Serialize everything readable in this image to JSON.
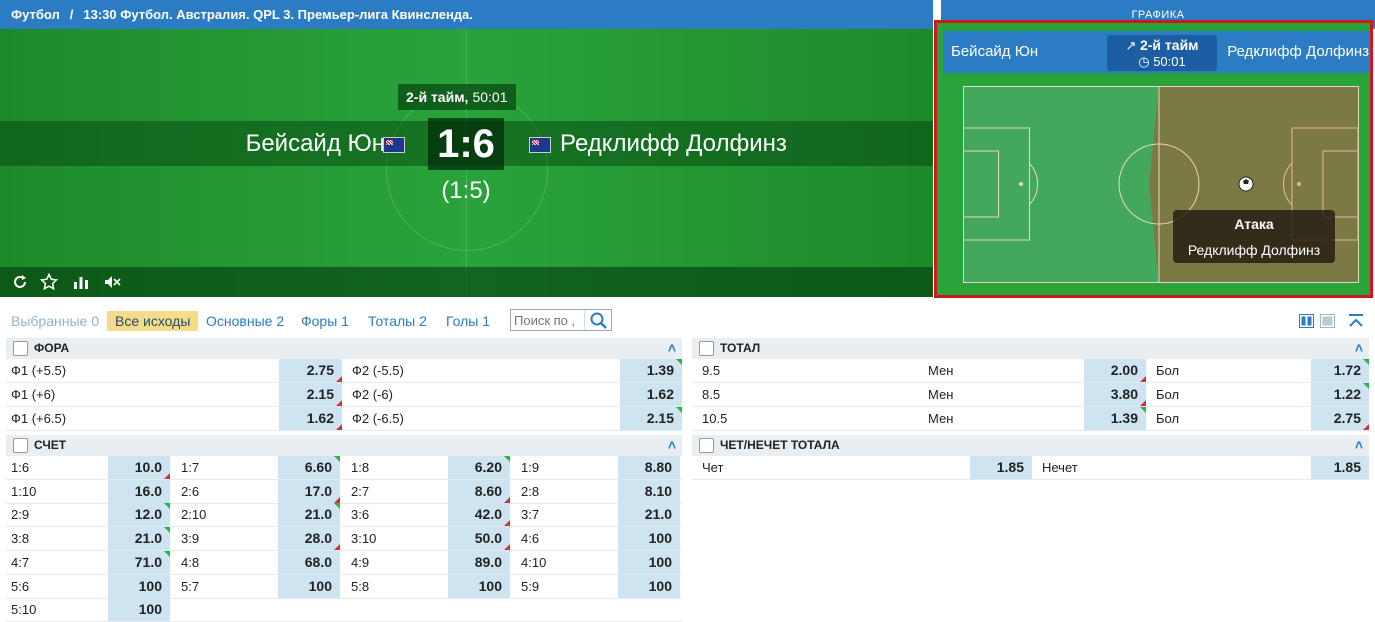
{
  "header": {
    "sport": "Футбол",
    "separator": "/",
    "match_title": "13:30 Футбол. Австралия. QPL 3. Премьер-лига Квинсленда."
  },
  "graphics_tab": "ГРАФИКА",
  "scoreboard": {
    "period": "2-й тайм,",
    "time": "50:01",
    "team1": "Бейсайд Юн",
    "team2": "Редклифф Долфинз",
    "score": "1:6",
    "half_score": "(1:5)"
  },
  "graphics": {
    "team1": "Бейсайд Юн",
    "team2": "Редклифф Долфинз",
    "period": "2-й тайм",
    "time": "50:01",
    "event_title": "Атака",
    "event_team": "Редклифф Долфинз"
  },
  "filters": [
    {
      "label": "Выбранные 0",
      "state": "disabled"
    },
    {
      "label": "Все исходы",
      "state": "active"
    },
    {
      "label": "Основные 2",
      "state": "normal"
    },
    {
      "label": "Форы 1",
      "state": "normal"
    },
    {
      "label": "Тоталы 2",
      "state": "normal"
    },
    {
      "label": "Голы 1",
      "state": "normal"
    }
  ],
  "search": {
    "placeholder": "Поиск по ,"
  },
  "fora": {
    "title": "ФОРА",
    "rows": [
      {
        "l1": "Ф1 (+5.5)",
        "o1": "2.75",
        "l2": "Ф2 (-5.5)",
        "o2": "1.39"
      },
      {
        "l1": "Ф1 (+6)",
        "o1": "2.15",
        "l2": "Ф2 (-6)",
        "o2": "1.62"
      },
      {
        "l1": "Ф1 (+6.5)",
        "o1": "1.62",
        "l2": "Ф2 (-6.5)",
        "o2": "2.15"
      }
    ]
  },
  "score": {
    "title": "СЧЕТ",
    "rows": [
      [
        [
          "1:6",
          "10.0"
        ],
        [
          "1:7",
          "6.60"
        ],
        [
          "1:8",
          "6.20"
        ],
        [
          "1:9",
          "8.80"
        ]
      ],
      [
        [
          "1:10",
          "16.0"
        ],
        [
          "2:6",
          "17.0"
        ],
        [
          "2:7",
          "8.60"
        ],
        [
          "2:8",
          "8.10"
        ]
      ],
      [
        [
          "2:9",
          "12.0"
        ],
        [
          "2:10",
          "21.0"
        ],
        [
          "3:6",
          "42.0"
        ],
        [
          "3:7",
          "21.0"
        ]
      ],
      [
        [
          "3:8",
          "21.0"
        ],
        [
          "3:9",
          "28.0"
        ],
        [
          "3:10",
          "50.0"
        ],
        [
          "4:6",
          "100"
        ]
      ],
      [
        [
          "4:7",
          "71.0"
        ],
        [
          "4:8",
          "68.0"
        ],
        [
          "4:9",
          "89.0"
        ],
        [
          "4:10",
          "100"
        ]
      ],
      [
        [
          "5:6",
          "100"
        ],
        [
          "5:7",
          "100"
        ],
        [
          "5:8",
          "100"
        ],
        [
          "5:9",
          "100"
        ]
      ],
      [
        [
          "5:10",
          "100"
        ]
      ]
    ]
  },
  "total": {
    "title": "ТОТАЛ",
    "rows": [
      {
        "line": "9.5",
        "under_label": "Мен",
        "under": "2.00",
        "over_label": "Бол",
        "over": "1.72"
      },
      {
        "line": "8.5",
        "under_label": "Мен",
        "under": "3.80",
        "over_label": "Бол",
        "over": "1.22"
      },
      {
        "line": "10.5",
        "under_label": "Мен",
        "under": "1.39",
        "over_label": "Бол",
        "over": "2.75"
      }
    ]
  },
  "oddeven": {
    "title": "ЧЕТ/НЕЧЕТ ТОТАЛА",
    "even_label": "Чет",
    "even": "1.85",
    "odd_label": "Нечет",
    "odd": "1.85"
  }
}
